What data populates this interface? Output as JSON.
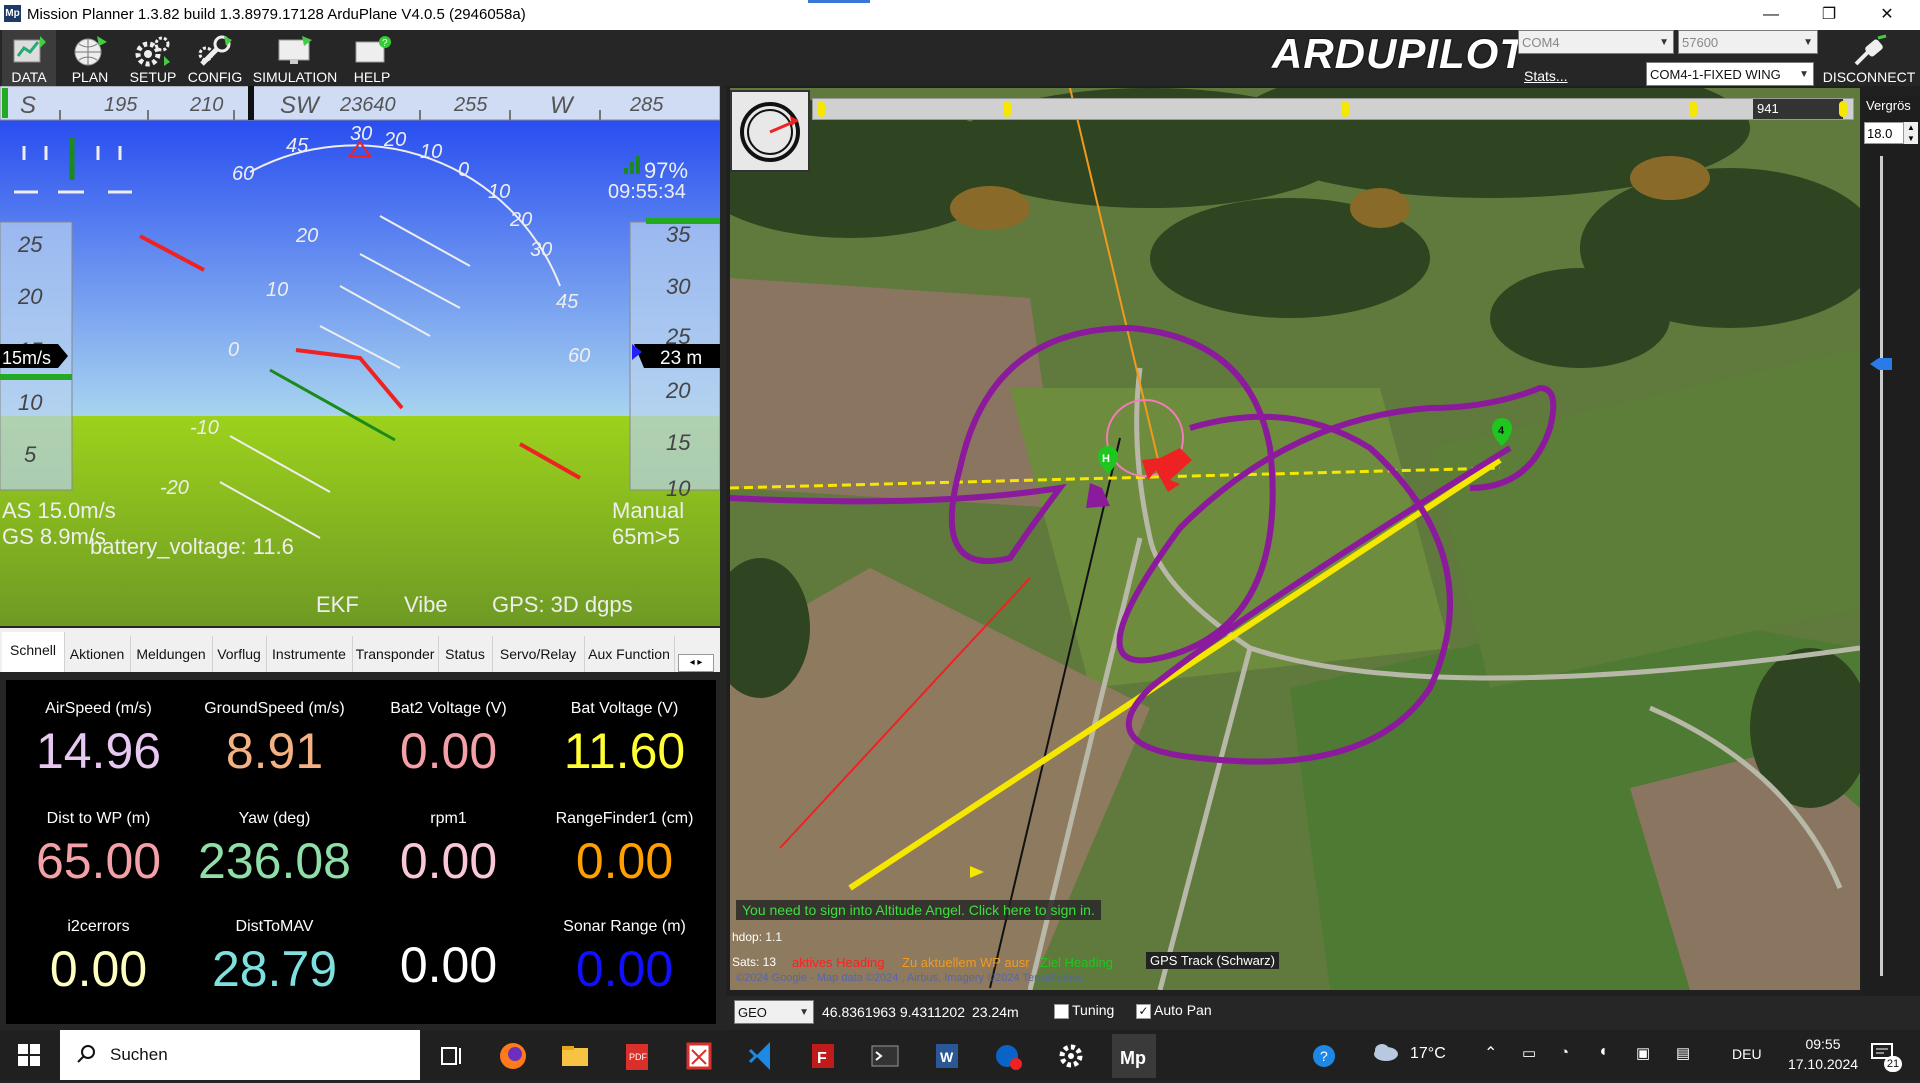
{
  "window": {
    "title": "Mission Planner 1.3.82 build 1.3.8979.17128 ArduPlane V4.0.5 (2946058a)",
    "app_icon_text": "Mp",
    "minimize": "—",
    "restore": "❐",
    "close": "✕"
  },
  "toolbar": {
    "buttons": [
      {
        "label": "DATA",
        "icon": "data-icon"
      },
      {
        "label": "PLAN",
        "icon": "globe-icon"
      },
      {
        "label": "SETUP",
        "icon": "gears-icon"
      },
      {
        "label": "CONFIG",
        "icon": "wrench-icon"
      },
      {
        "label": "SIMULATION",
        "icon": "monitor-icon"
      },
      {
        "label": "HELP",
        "icon": "help-monitor-icon"
      }
    ],
    "logo": "ARDUPILOT",
    "port": "COM4",
    "baud": "57600",
    "stats_link": "Stats...",
    "connection": "COM4-1-FIXED WING",
    "disconnect_label": "DISCONNECT"
  },
  "hud": {
    "heading_tape": [
      "S",
      "195",
      "210",
      "SW",
      "23640",
      "255",
      "W",
      "285"
    ],
    "pitch_labels_left": [
      "60",
      "45",
      "20",
      "10",
      "0",
      "-10",
      "-20"
    ],
    "roll_labels": [
      "30",
      "20",
      "10",
      "0",
      "10",
      "20",
      "30",
      "45",
      "60"
    ],
    "speed_tape": [
      "25",
      "20",
      "15",
      "10",
      "5"
    ],
    "speed_box": "15m/s",
    "alt_tape": [
      "35",
      "30",
      "25",
      "20",
      "15",
      "10"
    ],
    "alt_box": "23 m",
    "link_quality": "97%",
    "time": "09:55:34",
    "airspeed": "AS 15.0m/s",
    "groundspeed": "GS 8.9m/s",
    "battery": "battery_voltage: 11.6",
    "mode": "Manual",
    "wp_info": "65m>5",
    "ekf": "EKF",
    "vibe": "Vibe",
    "gps": "GPS: 3D dgps"
  },
  "tabs": [
    "Schnell",
    "Aktionen",
    "Meldungen",
    "Vorflug",
    "Instrumente",
    "Transponder",
    "Status",
    "Servo/Relay",
    "Aux Function"
  ],
  "active_tab": "Schnell",
  "quick": [
    {
      "label": "AirSpeed (m/s)",
      "value": "14.96",
      "color": "#e6c8f0"
    },
    {
      "label": "GroundSpeed (m/s)",
      "value": "8.91",
      "color": "#f4b183"
    },
    {
      "label": "Bat2 Voltage (V)",
      "value": "0.00",
      "color": "#f4a0a8"
    },
    {
      "label": "Bat Voltage (V)",
      "value": "11.60",
      "color": "#ffff33"
    },
    {
      "label": "Dist to WP (m)",
      "value": "65.00",
      "color": "#f4a0a8"
    },
    {
      "label": "Yaw (deg)",
      "value": "236.08",
      "color": "#8fe0a8"
    },
    {
      "label": "rpm1",
      "value": "0.00",
      "color": "#f8c8d8"
    },
    {
      "label": "RangeFinder1 (cm)",
      "value": "0.00",
      "color": "#ffa000"
    },
    {
      "label": "i2cerrors",
      "value": "0.00",
      "color": "#ffffc0"
    },
    {
      "label": "DistToMAV",
      "value": "28.79",
      "color": "#7fe0e0"
    },
    {
      "label": "",
      "value": "0.00",
      "color": "#ffffff"
    },
    {
      "label": "Sonar Range (m)",
      "value": "0.00",
      "color": "#1010ff"
    }
  ],
  "map": {
    "timeline_value": "941",
    "zoom_label": "Vergrös",
    "zoom_value": "18.0",
    "wp_home": "H",
    "wp_4": "4",
    "angel_message": "You need to sign into Altitude Angel. Click here to sign in.",
    "hdop": "hdop: 1.1",
    "sats": "Sats: 13",
    "legend_heading": "aktives Heading",
    "legend_wp": "Zu aktuellem WP ausr",
    "legend_target": "Ziel Heading",
    "legend_gps": "GPS Track (Schwarz)",
    "copyright": "©2024 Google - Map data ©2024 , Airbus, Imagery ©2024 TerraMetrics",
    "coord_system": "GEO",
    "coords": "46.8361963 9.4311202",
    "alt": "23.24m",
    "tuning": "Tuning",
    "tuning_checked": false,
    "autopan": "Auto Pan",
    "autopan_checked": true
  },
  "taskbar": {
    "search": "Suchen",
    "weather": "17°C",
    "lang": "DEU",
    "time": "09:55",
    "date": "17.10.2024",
    "notifications": "21"
  }
}
